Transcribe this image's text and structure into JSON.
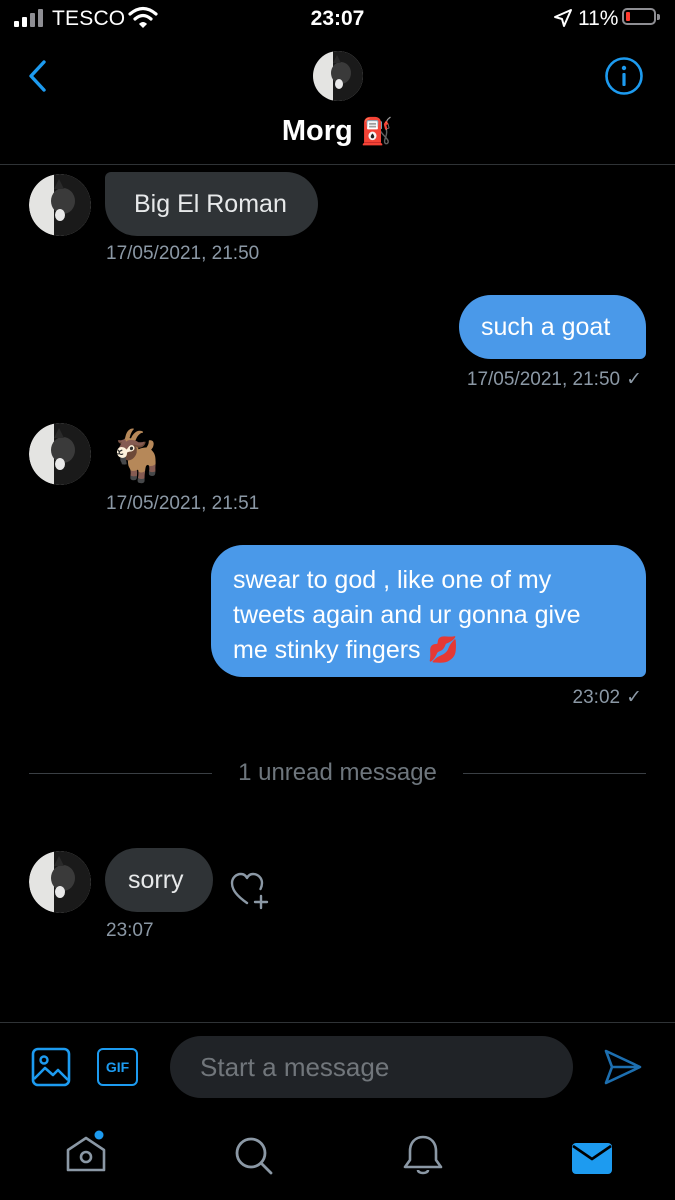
{
  "status_bar": {
    "carrier": "TESCO",
    "time": "23:07",
    "battery_pct": "11%",
    "battery_level": 0.11
  },
  "conversation": {
    "name": "Morg",
    "name_emoji": "⛽"
  },
  "messages": [
    {
      "dir": "in",
      "text": "Big El Roman",
      "time": "17/05/2021, 21:50"
    },
    {
      "dir": "out",
      "text": "such a goat",
      "time": "17/05/2021, 21:50"
    },
    {
      "dir": "in",
      "text": "🐐",
      "time": "17/05/2021, 21:51"
    },
    {
      "dir": "out",
      "lines": [
        "swear to god , like one of my",
        "tweets again and ur gonna give",
        "me stinky fingers 💋"
      ],
      "time": "23:02"
    },
    {
      "dir": "in",
      "text": "sorry",
      "time": "23:07"
    }
  ],
  "unread_divider": "1 unread message",
  "composer": {
    "placeholder": "Start a message",
    "gif_label": "GIF"
  },
  "colors": {
    "accent": "#1d9bf0",
    "outgoing_bubble": "#4a99e9",
    "incoming_bubble": "#2f3336"
  },
  "icons": [
    "back-chevron-icon",
    "info-icon",
    "image-icon",
    "gif-icon",
    "send-icon",
    "heart-plus-icon",
    "home-icon",
    "search-icon",
    "bell-icon",
    "mail-icon"
  ]
}
